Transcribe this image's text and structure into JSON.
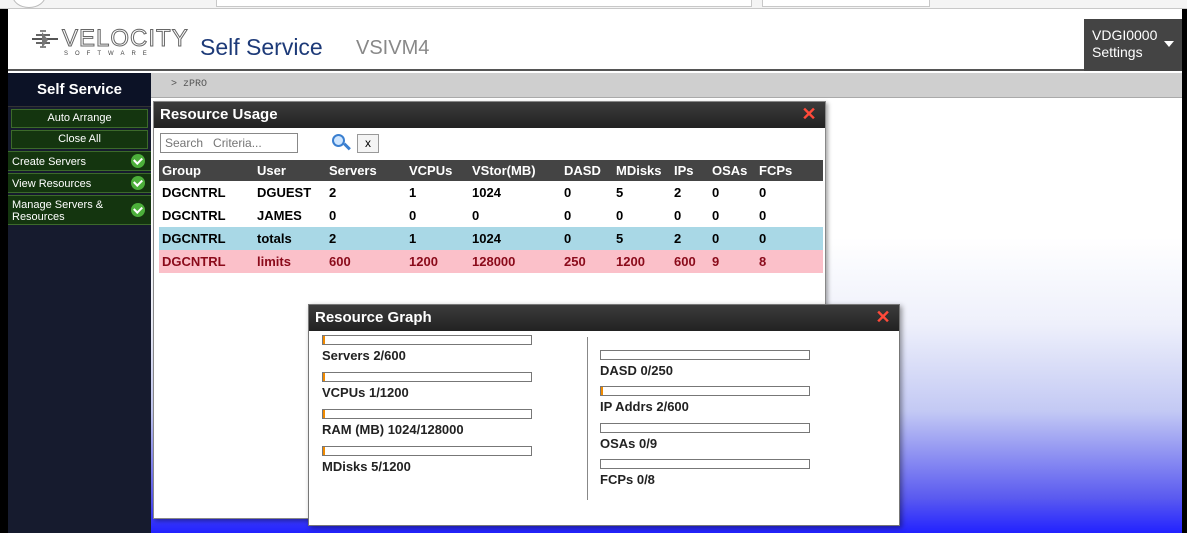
{
  "header": {
    "logo_text": "VELOCITY",
    "logo_sub": "SOFTWARE",
    "app_title": "Self Service",
    "host": "VSIVM4",
    "user_id": "VDGI0000",
    "settings_label": "Settings"
  },
  "sidebar": {
    "title": "Self Service",
    "actions": [
      {
        "label": "Auto Arrange"
      },
      {
        "label": "Close All"
      }
    ],
    "menus": [
      {
        "label": "Create Servers"
      },
      {
        "label": "View Resources"
      },
      {
        "label": "Manage Servers & Resources"
      }
    ]
  },
  "breadcrumb": "> zPRO",
  "resource_usage": {
    "title": "Resource Usage",
    "search_placeholder": "Search   Criteria...",
    "clear_label": "x",
    "columns": [
      "Group",
      "User",
      "Servers",
      "VCPUs",
      "VStor(MB)",
      "DASD",
      "MDisks",
      "IPs",
      "OSAs",
      "FCPs"
    ],
    "rows": [
      [
        "DGCNTRL",
        "DGUEST",
        "2",
        "1",
        "1024",
        "0",
        "5",
        "2",
        "0",
        "0"
      ],
      [
        "DGCNTRL",
        "JAMES",
        "0",
        "0",
        "0",
        "0",
        "0",
        "0",
        "0",
        "0"
      ],
      [
        "DGCNTRL",
        "totals",
        "2",
        "1",
        "1024",
        "0",
        "5",
        "2",
        "0",
        "0"
      ],
      [
        "DGCNTRL",
        "limits",
        "600",
        "1200",
        "128000",
        "250",
        "1200",
        "600",
        "9",
        "8"
      ]
    ]
  },
  "resource_graph": {
    "title": "Resource Graph",
    "left": [
      {
        "label": "Servers 2/600",
        "fill": 0.0033
      },
      {
        "label": "VCPUs 1/1200",
        "fill": 0.0008
      },
      {
        "label": "RAM (MB) 1024/128000",
        "fill": 0.008
      },
      {
        "label": "MDisks 5/1200",
        "fill": 0.0042
      }
    ],
    "right": [
      {
        "label": "DASD 0/250",
        "fill": 0
      },
      {
        "label": "IP Addrs 2/600",
        "fill": 0.0033
      },
      {
        "label": "OSAs 0/9",
        "fill": 0
      },
      {
        "label": "FCPs 0/8",
        "fill": 0
      }
    ]
  },
  "colors": {
    "totals_row": "#a9d8e6",
    "limits_row": "#fbc0c9",
    "bar_fill": "#f08a00",
    "sidebar_green": "#14350f"
  }
}
